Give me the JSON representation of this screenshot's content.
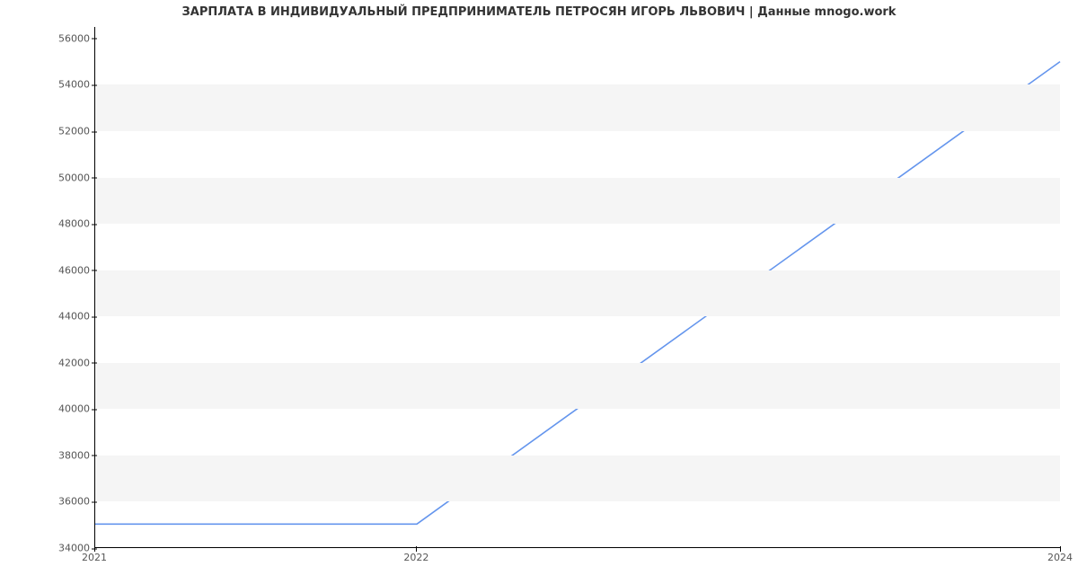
{
  "chart_data": {
    "type": "line",
    "title": "ЗАРПЛАТА В ИНДИВИДУАЛЬНЫЙ ПРЕДПРИНИМАТЕЛЬ ПЕТРОСЯН ИГОРЬ ЛЬВОВИЧ | Данные mnogo.work",
    "xlabel": "",
    "ylabel": "",
    "x_ticks": [
      2021,
      2022,
      2024
    ],
    "y_ticks": [
      34000,
      36000,
      38000,
      40000,
      42000,
      44000,
      46000,
      48000,
      50000,
      52000,
      54000,
      56000
    ],
    "xlim": [
      2021,
      2024
    ],
    "ylim": [
      34000,
      56500
    ],
    "series": [
      {
        "name": "salary",
        "color": "#6495ed",
        "x": [
          2021,
          2022,
          2024
        ],
        "y": [
          35000,
          35000,
          55000
        ]
      }
    ]
  }
}
